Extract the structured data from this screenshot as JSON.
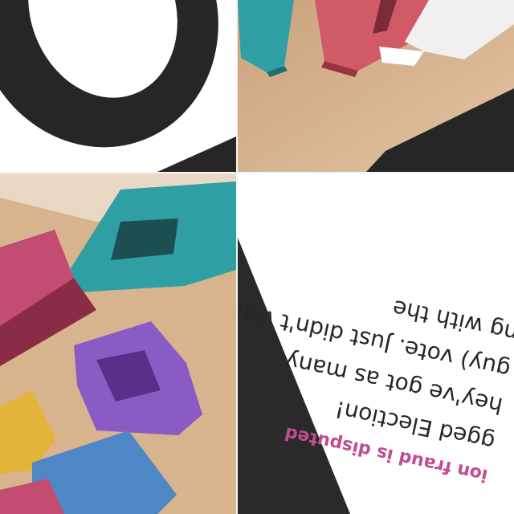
{
  "tiles": {
    "top_left": {
      "icon": "large-black-letter-o-glyph"
    },
    "top_right": {
      "icon": "wooden-letter-blocks-on-table"
    },
    "bottom_left": {
      "icon": "colorful-wooden-letters-d-a-w"
    },
    "bottom_right": {
      "caption": "ion fraud is disputed",
      "lines": [
        "gged Election!",
        "hey've got as many",
        "guy) vote. Just didn't wan",
        "ng with the"
      ]
    }
  },
  "colors": {
    "dark": "#262626",
    "wood": "#d8b48e",
    "teal": "#2f9fa3",
    "pink": "#c24c72",
    "purple": "#8a5bc4",
    "caption_magenta": "#c24c92"
  }
}
